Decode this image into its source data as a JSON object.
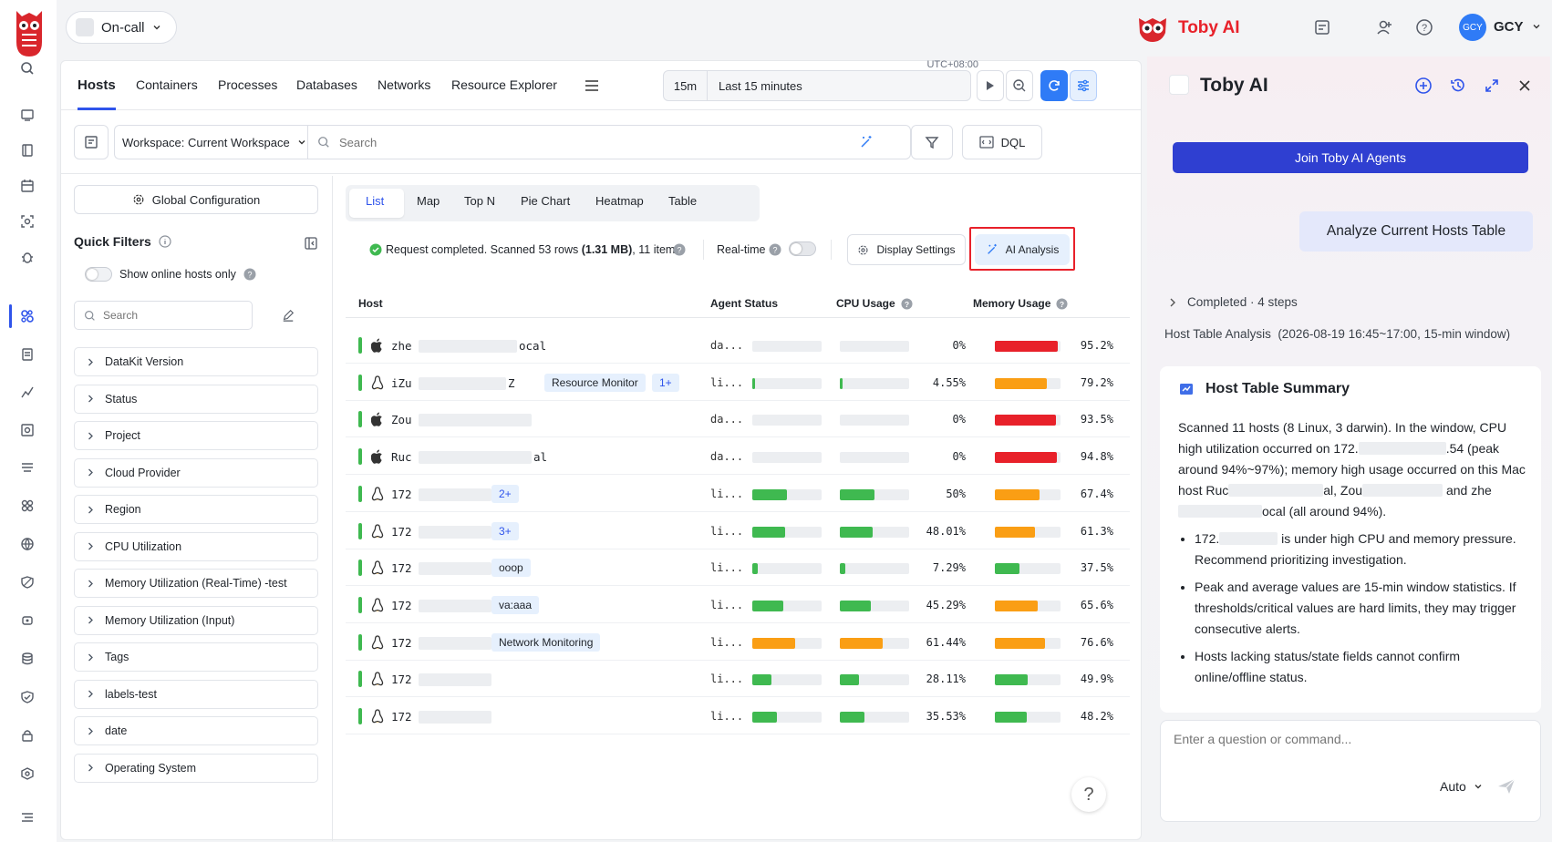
{
  "topbar": {
    "oncall_label": "On-call",
    "brand_name": "Toby AI",
    "user_avatar": "GCY",
    "user_name": "GCY"
  },
  "nav_tabs": [
    "Hosts",
    "Containers",
    "Processes",
    "Databases",
    "Networks",
    "Resource Explorer"
  ],
  "time": {
    "timezone": "UTC+08:00",
    "quick": "15m",
    "range": "Last 15 minutes"
  },
  "toolbar": {
    "workspace": "Workspace: Current Workspace",
    "search_placeholder": "Search",
    "dql": "DQL"
  },
  "filters": {
    "global_config": "Global Configuration",
    "quick_filters": "Quick Filters",
    "online_only": "Show online hosts only",
    "search_placeholder": "Search",
    "facets": [
      "DataKit Version",
      "Status",
      "Project",
      "Cloud Provider",
      "Region",
      "CPU Utilization",
      "Memory Utilization (Real-Time) -test",
      "Memory Utilization (Input)",
      "Tags",
      "labels-test",
      "date",
      "Operating System"
    ]
  },
  "views": [
    "List",
    "Map",
    "Top N",
    "Pie Chart",
    "Heatmap",
    "Table"
  ],
  "status": {
    "prefix": "Request completed. Scanned ",
    "rows": "53",
    "mid": " rows ",
    "size": "(1.31 MB)",
    "suffix": ", 11 items.",
    "realtime": "Real-time",
    "display_settings": "Display Settings",
    "ai_analysis": "AI Analysis"
  },
  "table": {
    "headers": [
      "Host",
      "Agent Status",
      "CPU Usage",
      "Memory Usage"
    ],
    "rows": [
      {
        "os": "apple",
        "prefix": "zhe",
        "suffix": "ocal",
        "tag": "",
        "tag2": "",
        "agent": "da...",
        "agent_pct": 0,
        "cpu": "0%",
        "cpu_pct": 0,
        "cpu_color": "#3fb950",
        "mem": "95.2%",
        "mem_pct": 95.2,
        "mem_color": "#e8212a"
      },
      {
        "os": "linux",
        "prefix": "iZu",
        "suffix": "Z",
        "tag": "Resource Monitor",
        "tag2": "1+",
        "agent": "li...",
        "agent_pct": 4.55,
        "cpu": "4.55%",
        "cpu_pct": 4.55,
        "cpu_color": "#3fb950",
        "mem": "79.2%",
        "mem_pct": 79.2,
        "mem_color": "#fa9e14"
      },
      {
        "os": "apple",
        "prefix": "Zou",
        "suffix": "",
        "tag": "",
        "tag2": "",
        "agent": "da...",
        "agent_pct": 0,
        "cpu": "0%",
        "cpu_pct": 0,
        "cpu_color": "#3fb950",
        "mem": "93.5%",
        "mem_pct": 93.5,
        "mem_color": "#e8212a"
      },
      {
        "os": "apple",
        "prefix": "Ruc",
        "suffix": "al",
        "tag": "",
        "tag2": "",
        "agent": "da...",
        "agent_pct": 0,
        "cpu": "0%",
        "cpu_pct": 0,
        "cpu_color": "#3fb950",
        "mem": "94.8%",
        "mem_pct": 94.8,
        "mem_color": "#e8212a"
      },
      {
        "os": "linux",
        "prefix": "172",
        "suffix": "",
        "tag": "",
        "tag2": "2+",
        "agent": "li...",
        "agent_pct": 50,
        "cpu": "50%",
        "cpu_pct": 50,
        "cpu_color": "#3fb950",
        "mem": "67.4%",
        "mem_pct": 67.4,
        "mem_color": "#fa9e14"
      },
      {
        "os": "linux",
        "prefix": "172",
        "suffix": "",
        "tag": "",
        "tag2": "3+",
        "agent": "li...",
        "agent_pct": 48.01,
        "cpu": "48.01%",
        "cpu_pct": 48.01,
        "cpu_color": "#3fb950",
        "mem": "61.3%",
        "mem_pct": 61.3,
        "mem_color": "#fa9e14"
      },
      {
        "os": "linux",
        "prefix": "172",
        "suffix": "",
        "tag": "ooop",
        "tag2": "",
        "agent": "li...",
        "agent_pct": 7.29,
        "cpu": "7.29%",
        "cpu_pct": 7.29,
        "cpu_color": "#3fb950",
        "mem": "37.5%",
        "mem_pct": 37.5,
        "mem_color": "#3fb950"
      },
      {
        "os": "linux",
        "prefix": "172",
        "suffix": "",
        "tag": "va:aaa",
        "tag2": "",
        "agent": "li...",
        "agent_pct": 45.29,
        "cpu": "45.29%",
        "cpu_pct": 45.29,
        "cpu_color": "#3fb950",
        "mem": "65.6%",
        "mem_pct": 65.6,
        "mem_color": "#fa9e14"
      },
      {
        "os": "linux",
        "prefix": "172",
        "suffix": "",
        "tag": "Network Monitoring",
        "tag2": "",
        "agent": "li...",
        "agent_pct": 61.44,
        "cpu": "61.44%",
        "cpu_pct": 61.44,
        "cpu_color": "#fa9e14",
        "mem": "76.6%",
        "mem_pct": 76.6,
        "mem_color": "#fa9e14"
      },
      {
        "os": "linux",
        "prefix": "172",
        "suffix": "",
        "tag": "",
        "tag2": "",
        "agent": "li...",
        "agent_pct": 28.11,
        "cpu": "28.11%",
        "cpu_pct": 28.11,
        "cpu_color": "#3fb950",
        "mem": "49.9%",
        "mem_pct": 49.9,
        "mem_color": "#3fb950"
      },
      {
        "os": "linux",
        "prefix": "172",
        "suffix": "",
        "tag": "",
        "tag2": "",
        "agent": "li...",
        "agent_pct": 35.53,
        "cpu": "35.53%",
        "cpu_pct": 35.53,
        "cpu_color": "#3fb950",
        "mem": "48.2%",
        "mem_pct": 48.2,
        "mem_color": "#3fb950"
      }
    ]
  },
  "ai": {
    "title": "Toby AI",
    "join": "Join Toby AI Agents",
    "prompt": "Analyze Current Hosts Table",
    "completed": "Completed · 4 steps",
    "analysis_title": "Host Table Analysis  (2026-08-19 16:45~17:00, 15-min window)",
    "summary_title": "Host Table Summary",
    "p1a": "Scanned 11 hosts (8 Linux, 3 darwin). In the window, CPU high utilization occurred on 172.",
    "p1b": ".54 (peak around 94%~97%); memory high usage occurred on this Mac host Ruc",
    "p1c": "al, Zou",
    "p1d": " and zhe",
    "p1e": "ocal (all around 94%).",
    "b1a": "172.",
    "b1b": " is under high CPU and memory pressure. Recommend prioritizing investigation.",
    "b2": "Peak and average values are 15-min window statistics. If thresholds/critical values are hard limits, they may trigger consecutive alerts.",
    "b3": "Hosts lacking status/state fields cannot confirm online/offline status.",
    "input_placeholder": "Enter a question or command...",
    "mode": "Auto"
  },
  "colors": {
    "accent": "#2f54eb",
    "primary_button": "#2f3fd1",
    "ok": "#3fb950",
    "warn": "#fa9e14",
    "crit": "#e8212a"
  },
  "icons": [
    "owl-logo-icon",
    "search-icon",
    "monitor-icon",
    "book-icon",
    "calendar-icon",
    "scan-icon",
    "bug-icon",
    "users-icon",
    "document-icon",
    "chart-icon",
    "report-icon",
    "list-icon",
    "apps-icon",
    "globe-icon",
    "shield-icon",
    "settings-icon",
    "database-icon",
    "lock-icon",
    "hex-icon",
    "menu-icon",
    "apple-icon",
    "linux-icon"
  ]
}
